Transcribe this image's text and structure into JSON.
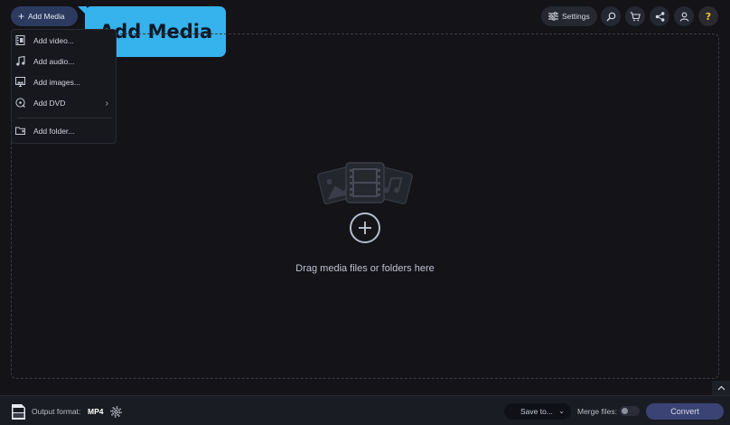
{
  "toolbar": {
    "add_media_label": "Add Media",
    "settings_label": "Settings",
    "icons": [
      "search-icon",
      "cart-icon",
      "share-icon",
      "account-icon",
      "help-icon"
    ],
    "help_glyph": "?"
  },
  "tooltip": {
    "text": "Add Media",
    "color": "#36b2ec"
  },
  "menu": {
    "items": [
      {
        "label": "Add video...",
        "icon": "video-file-icon"
      },
      {
        "label": "Add audio...",
        "icon": "music-note-icon"
      },
      {
        "label": "Add images...",
        "icon": "image-icon"
      },
      {
        "label": "Add DVD",
        "icon": "dvd-icon",
        "submenu_arrow": "›"
      },
      {
        "label": "Add folder...",
        "icon": "folder-icon"
      }
    ]
  },
  "drop_zone": {
    "hint": "Drag media files or folders here"
  },
  "bottom": {
    "output_label": "Output format:",
    "output_value": "MP4",
    "save_to_label": "Save to...",
    "save_caret": "⌄",
    "merge_label": "Merge files:",
    "merge_enabled": false,
    "convert_label": "Convert"
  },
  "colors": {
    "background": "#131318",
    "accent": "#36b2ec",
    "primary_button": "#3a4373"
  }
}
